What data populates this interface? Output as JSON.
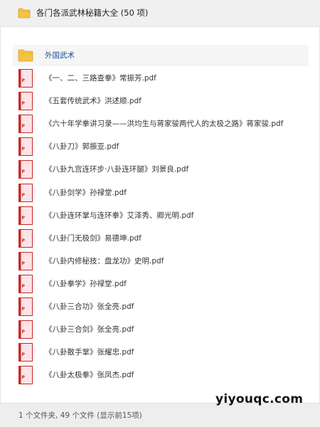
{
  "header": {
    "title": "各门各派武林秘籍大全 (50 项)",
    "icon": "folder-icon"
  },
  "list": {
    "folder": {
      "name": "外国武术",
      "icon": "folder-icon"
    },
    "files": [
      {
        "name": "《一、二、三路查拳》常振芳.pdf",
        "icon": "pdf-file-icon"
      },
      {
        "name": "《五套传统武术》洪述顺.pdf",
        "icon": "pdf-file-icon"
      },
      {
        "name": "《六十年学拳讲习录——洪均生与蒋家骏两代人的太极之路》蒋家骏.pdf",
        "icon": "pdf-file-icon"
      },
      {
        "name": "《八卦刀》郭振亚.pdf",
        "icon": "pdf-file-icon"
      },
      {
        "name": "《八卦九宫连环步·八卦连环腿》刘景良.pdf",
        "icon": "pdf-file-icon"
      },
      {
        "name": "《八卦剑学》孙禄堂.pdf",
        "icon": "pdf-file-icon"
      },
      {
        "name": "《八卦连环掌与连环拳》艾泽秀、卿光明.pdf",
        "icon": "pdf-file-icon"
      },
      {
        "name": "《八卦门无极剑》易德坤.pdf",
        "icon": "pdf-file-icon"
      },
      {
        "name": "《八卦内修秘技：盘龙功》史明.pdf",
        "icon": "pdf-file-icon"
      },
      {
        "name": "《八卦拳学》孙禄堂.pdf",
        "icon": "pdf-file-icon"
      },
      {
        "name": "《八卦三合功》张全亮.pdf",
        "icon": "pdf-file-icon"
      },
      {
        "name": "《八卦三合剑》张全亮.pdf",
        "icon": "pdf-file-icon"
      },
      {
        "name": "《八卦散手掌》张耀忠.pdf",
        "icon": "pdf-file-icon"
      },
      {
        "name": "《八卦太极拳》张凤杰.pdf",
        "icon": "pdf-file-icon"
      }
    ]
  },
  "footer": {
    "summary": "1 个文件夹, 49 个文件 (显示前15项)"
  },
  "watermark": {
    "text": "yiyouqc.com"
  },
  "colors": {
    "folder": "#f5c242",
    "folder_dark": "#e0a82e",
    "pdf_red": "#c62828",
    "pdf_bg": "#fbe3e6",
    "folder_link": "#1a4d99"
  }
}
